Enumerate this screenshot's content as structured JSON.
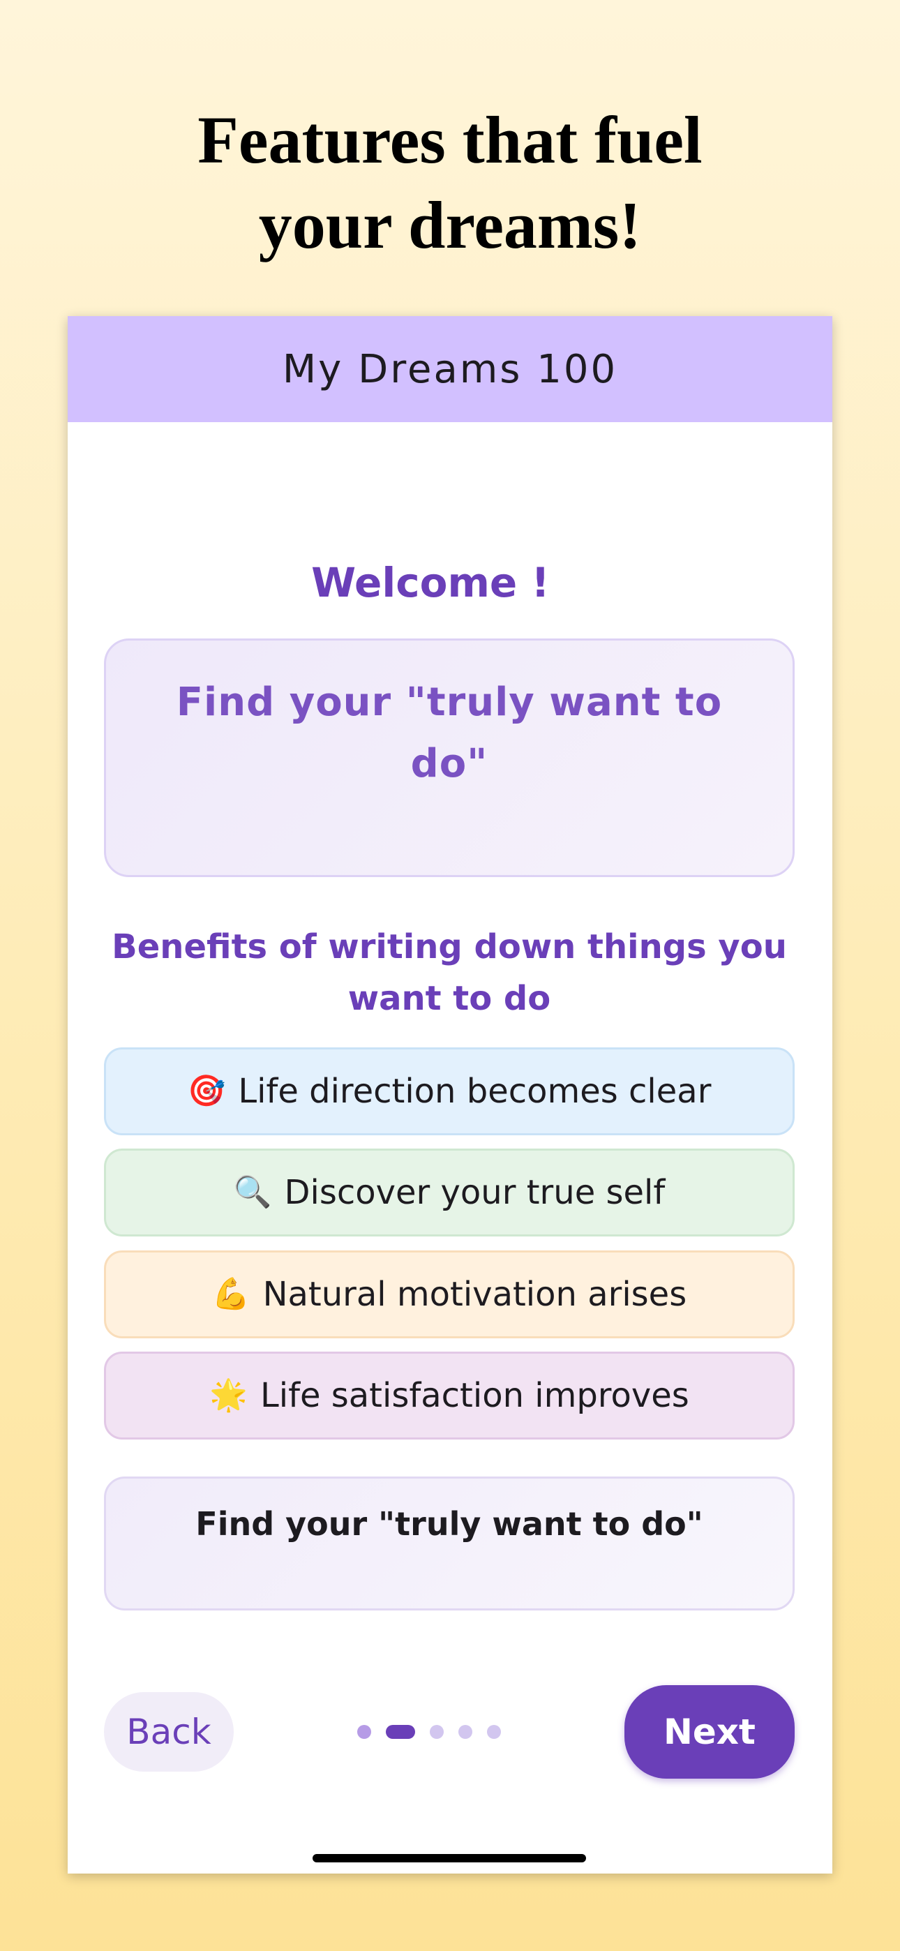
{
  "headline": {
    "line1": "Features that fuel",
    "line2": "your dreams!"
  },
  "app": {
    "title": "My Dreams 100",
    "welcome": "Welcome !",
    "hero_line1": "Find your \"truly want to",
    "hero_line2": "do\"",
    "benefits_title": "Benefits of writing down things you want to do",
    "benefits": [
      {
        "emoji": "🎯",
        "label": "Life direction becomes clear"
      },
      {
        "emoji": "🔍",
        "label": "Discover your true self"
      },
      {
        "emoji": "💪",
        "label": "Natural motivation arises"
      },
      {
        "emoji": "🌟",
        "label": "Life satisfaction improves"
      }
    ],
    "cta_card": "Find your \"truly want to do\"",
    "nav": {
      "back_label": "Back",
      "next_label": "Next",
      "page_total": 5,
      "page_current": 2
    }
  },
  "colors": {
    "accent": "#6A3FB8",
    "appbar": "#D2C0FF"
  }
}
